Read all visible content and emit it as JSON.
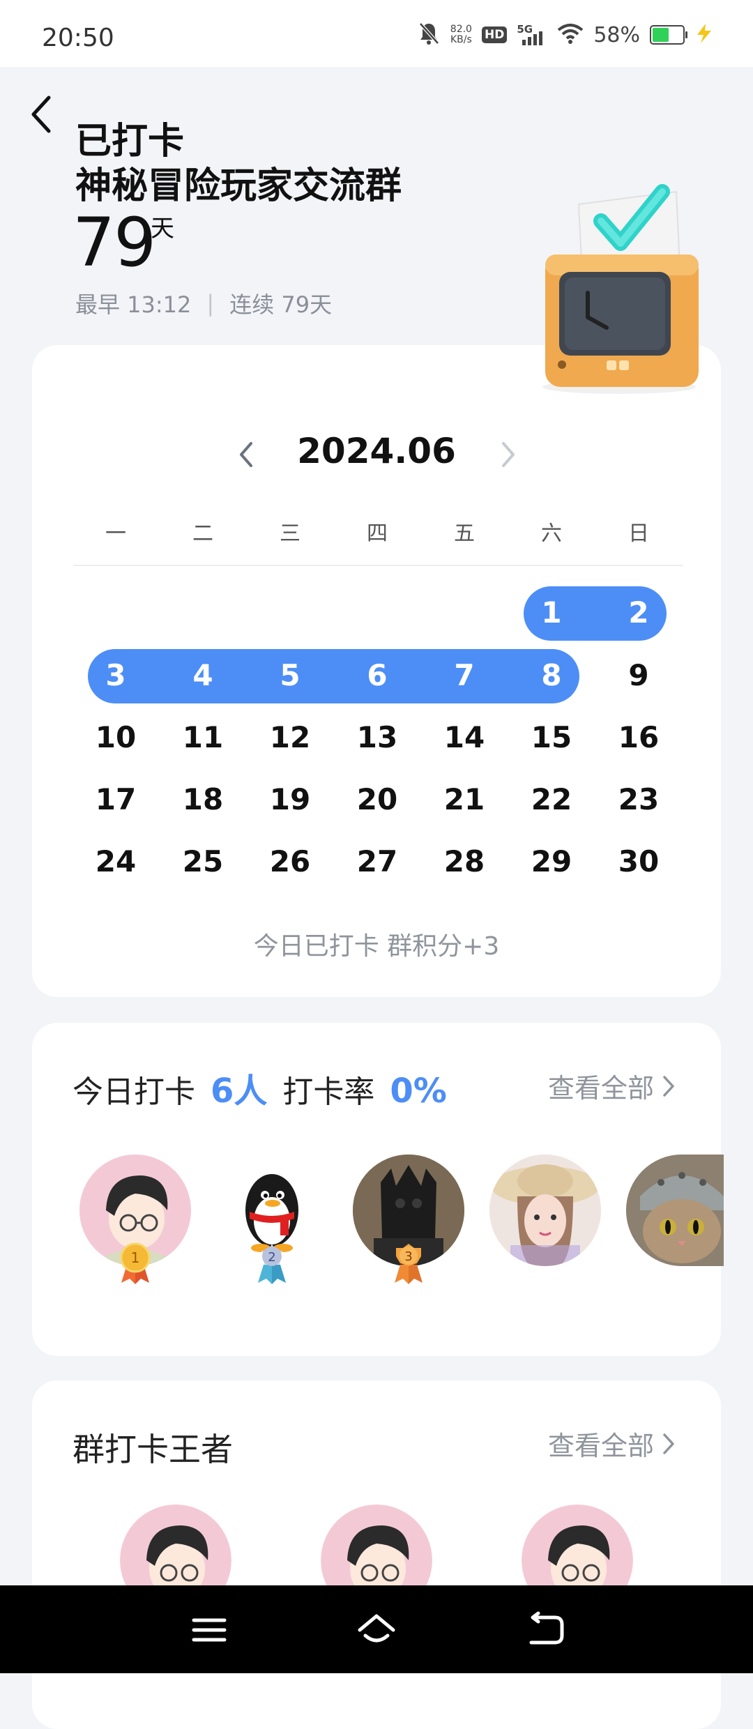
{
  "status_bar": {
    "time": "20:50",
    "speed_value": "82.0",
    "speed_unit": "KB/s",
    "hd": "HD",
    "network": "5G",
    "battery_pct": "58%",
    "battery_level": 0.58,
    "icons": [
      "bell-muted-icon",
      "wifi-icon",
      "battery-icon",
      "charging-bolt-icon"
    ]
  },
  "header": {
    "status_title": "已打卡",
    "group_name": "神秘冒险玩家交流群",
    "days_count": "79",
    "days_unit": "天",
    "earliest": "最早 13:12",
    "separator": "|",
    "streak": "连续 79天"
  },
  "calendar": {
    "month": "2024.06",
    "weekdays": [
      "一",
      "二",
      "三",
      "四",
      "五",
      "六",
      "日"
    ],
    "weeks": [
      [
        "",
        "",
        "",
        "",
        "",
        "1",
        "2"
      ],
      [
        "3",
        "4",
        "5",
        "6",
        "7",
        "8",
        "9"
      ],
      [
        "10",
        "11",
        "12",
        "13",
        "14",
        "15",
        "16"
      ],
      [
        "17",
        "18",
        "19",
        "20",
        "21",
        "22",
        "23"
      ],
      [
        "24",
        "25",
        "26",
        "27",
        "28",
        "29",
        "30"
      ]
    ],
    "checked_days": [
      1,
      2,
      3,
      4,
      5,
      6,
      7,
      8
    ],
    "highlight_color": "#4d8ef6",
    "today_note": "今日已打卡  群积分+3"
  },
  "today_checkin": {
    "label": "今日打卡",
    "count": "6人",
    "rate_label": "打卡率",
    "rate": "0%",
    "view_all": "查看全部",
    "avatars": [
      {
        "name": "cartoon-boy-avatar",
        "rank": "1"
      },
      {
        "name": "qq-penguin-avatar",
        "rank": "2"
      },
      {
        "name": "dark-statue-avatar",
        "rank": "3"
      },
      {
        "name": "girl-sunhat-avatar",
        "rank": ""
      },
      {
        "name": "cat-avatar",
        "rank": ""
      }
    ]
  },
  "king": {
    "title": "群打卡王者",
    "view_all": "查看全部"
  },
  "nav": {
    "icons": [
      "menu-icon",
      "home-icon",
      "back-icon"
    ]
  }
}
